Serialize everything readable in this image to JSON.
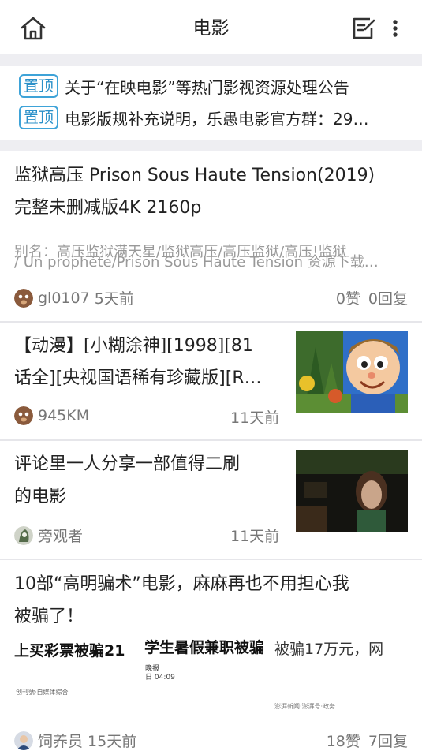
{
  "header": {
    "title": "电影",
    "home_icon": "home-icon",
    "edit_icon": "edit-post-icon",
    "more_icon": "more-vertical-icon"
  },
  "pinned": [
    {
      "badge": "置顶",
      "text": "关于“在映电影”等热门影视资源处理公告"
    },
    {
      "badge": "置顶",
      "text": "电影版规补充说明，乐愚电影官方群：29…"
    }
  ],
  "posts": [
    {
      "title_line1": "监狱高压 Prison Sous Haute Tension(2019)",
      "title_line2": "完整未删减版4K 2160p",
      "alias_line1": "别名：高压监狱满天星/监狱高压/高压监狱/高压!监狱",
      "alias_line2": "/ Un prophète/Prison Sous Haute Tension 资源下载…",
      "author": "gl0107",
      "time": "5天前",
      "likes": "0赞",
      "replies": "0回复"
    },
    {
      "title_line1": "【动漫】[小糊涂神][1998][81",
      "title_line2": "话全][央视国语稀有珍藏版][R…",
      "author": "945KM",
      "time": "11天前"
    },
    {
      "title_line1": "评论里一人分享一部值得二刷",
      "title_line2": "的电影",
      "author": "旁观者",
      "time": "11天前"
    },
    {
      "title_line1": "10部“高明骗术”电影，麻麻再也不用担心我",
      "title_line2": "被骗了！",
      "preview": {
        "headline_a": "上买彩票被骗21",
        "headline_b": "学生暑假兼职被骗",
        "headline_c": "被骗17万元，网",
        "small_a": "晚报",
        "small_b": "日  04:09",
        "caption_left": "创刊號·自媒体综合",
        "caption_right": "澎湃新闻·澎湃号·政务"
      },
      "author": "饲养员",
      "time": "15天前",
      "likes": "18赞",
      "replies": "7回复"
    }
  ]
}
